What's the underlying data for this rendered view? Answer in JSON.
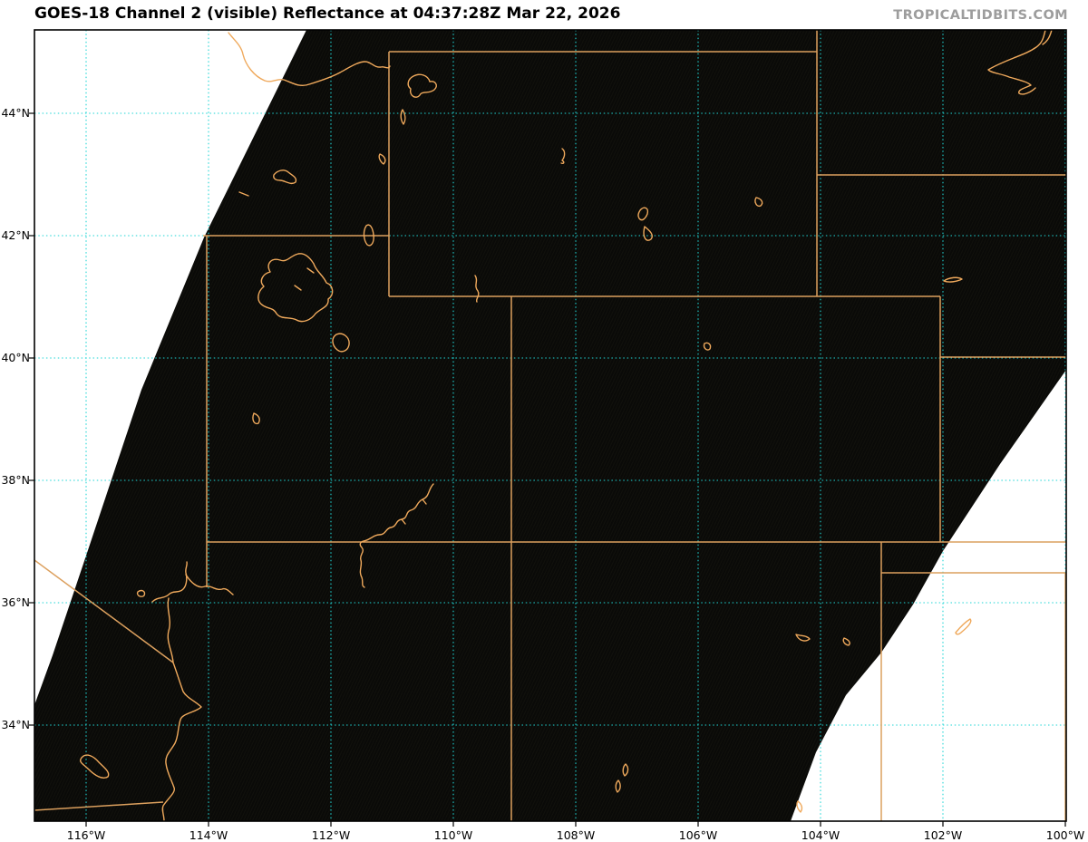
{
  "title": "GOES-18 Channel 2 (visible) Reflectance at 04:37:28Z Mar 22, 2026",
  "watermark": "TROPICALTIDBITS.COM",
  "axes": {
    "lat": [
      {
        "label": "44°N"
      },
      {
        "label": "42°N"
      },
      {
        "label": "40°N"
      },
      {
        "label": "38°N"
      },
      {
        "label": "36°N"
      },
      {
        "label": "34°N"
      }
    ],
    "lon": [
      {
        "label": "116°W"
      },
      {
        "label": "114°W"
      },
      {
        "label": "112°W"
      },
      {
        "label": "110°W"
      },
      {
        "label": "108°W"
      },
      {
        "label": "106°W"
      },
      {
        "label": "104°W"
      },
      {
        "label": "102°W"
      },
      {
        "label": "100°W"
      }
    ]
  },
  "colors": {
    "state_border_orange": "#dca05e",
    "water_feature_orange": "#efa95c",
    "graticule_cyan": "#1fd6d6",
    "satellite_swath_black": "#0a0a08",
    "no_data_white": "#ffffff",
    "watermark_gray": "#9d9d9d",
    "title_black": "#000000"
  }
}
